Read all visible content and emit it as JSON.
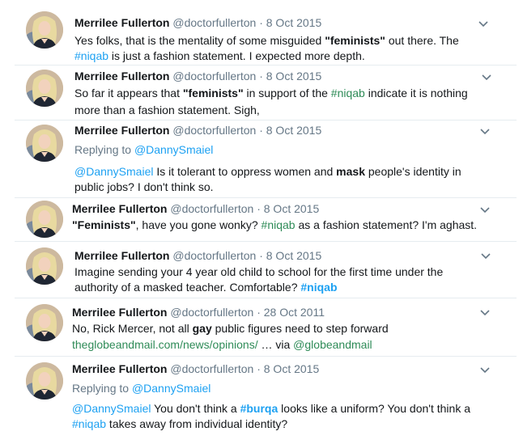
{
  "tweets": [
    {
      "name": "Merrilee Fullerton",
      "handle": "@doctorfullerton",
      "dot": "·",
      "date": "8 Oct 2015",
      "l1a": "Yes folks, that is the mentality of some misguided ",
      "l1kw": "\"feminists\"",
      "l1b": " out there. The",
      "l2tag": "#niqab",
      "l2a": " is just a fashion statement. I expected more depth."
    },
    {
      "name": "Merrilee Fullerton",
      "handle": "@doctorfullerton",
      "dot": "·",
      "date": "8 Oct 2015",
      "l1a": "So far it appears that ",
      "l1kw": "\"feminists\"",
      "l1b": " in support of the ",
      "l1tag": "#niqab",
      "l1c": " indicate it is nothing",
      "l2a": "more than a fashion statement. Sigh,"
    },
    {
      "name": "Merrilee Fullerton",
      "handle": "@doctorfullerton",
      "dot": "·",
      "date": "8 Oct 2015",
      "reply_prefix": "Replying to ",
      "reply_user": "@DannySmaiel",
      "l1mention": "@DannySmaiel",
      "l1a": " Is it tolerant to oppress women and ",
      "l1kw": "mask",
      "l1b": " people's identity in",
      "l2a": "public jobs? I don't think so."
    },
    {
      "name": "Merrilee Fullerton",
      "handle": "@doctorfullerton",
      "dot": "·",
      "date": "8 Oct 2015",
      "l1kw": "\"Feminists\"",
      "l1a": ", have you gone wonky? ",
      "l1tag": "#niqab",
      "l1b": " as a fashion statement? I'm aghast."
    },
    {
      "name": "Merrilee Fullerton",
      "handle": "@doctorfullerton",
      "dot": "·",
      "date": "8 Oct 2015",
      "l1a": "Imagine sending your 4 year old child to school for the first time under the",
      "l2a": "authority of a masked teacher. Comfortable? ",
      "l2tag": "#niqab"
    },
    {
      "name": "Merrilee Fullerton",
      "handle": "@doctorfullerton",
      "dot": "·",
      "date": "28 Oct 2011",
      "l1a": "No, Rick Mercer, not all ",
      "l1kw": "gay",
      "l1b": " public figures need to step forward",
      "l2link": "theglobeandmail.com/news/opinions/",
      "l2a": " … via ",
      "l2mention": "@globeandmail"
    },
    {
      "name": "Merrilee Fullerton",
      "handle": "@doctorfullerton",
      "dot": "·",
      "date": "8 Oct 2015",
      "reply_prefix": "Replying to ",
      "reply_user": "@DannySmaiel",
      "l1mention": "@DannySmaiel",
      "l1a": " You don't think a ",
      "l1tag": "#burqa",
      "l1b": " looks like a uniform? You don't think a",
      "l2tag": "#niqab",
      "l2a": " takes away from individual identity?"
    }
  ]
}
